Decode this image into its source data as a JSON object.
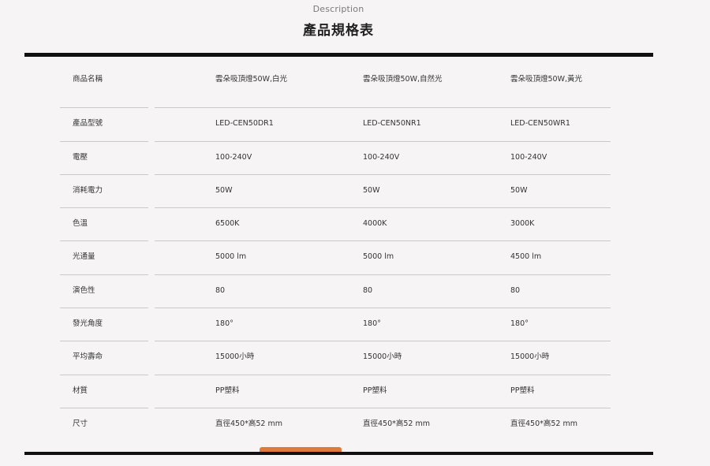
{
  "header": {
    "kicker": "Description",
    "title": "產品規格表"
  },
  "spec_table": {
    "rows": [
      {
        "label": "商品名稱",
        "values": [
          "雲朵吸頂燈50W,白光",
          "雲朵吸頂燈50W,自然光",
          "雲朵吸頂燈50W,黃光"
        ]
      },
      {
        "label": "產品型號",
        "values": [
          "LED-CEN50DR1",
          "LED-CEN50NR1",
          "LED-CEN50WR1"
        ]
      },
      {
        "label": "電壓",
        "values": [
          "100-240V",
          "100-240V",
          "100-240V"
        ]
      },
      {
        "label": "消耗電力",
        "values": [
          "50W",
          "50W",
          "50W"
        ]
      },
      {
        "label": "色溫",
        "values": [
          "6500K",
          "4000K",
          "3000K"
        ]
      },
      {
        "label": "光通量",
        "values": [
          "5000 lm",
          "5000 lm",
          "4500 lm"
        ]
      },
      {
        "label": "演色性",
        "values": [
          "80",
          "80",
          "80"
        ]
      },
      {
        "label": "發光角度",
        "values": [
          "180°",
          "180°",
          "180°"
        ]
      },
      {
        "label": "平均壽命",
        "values": [
          "15000小時",
          "15000小時",
          "15000小時"
        ]
      },
      {
        "label": "材質",
        "values": [
          "PP塑料",
          "PP塑料",
          "PP塑料"
        ]
      },
      {
        "label": "尺寸",
        "values": [
          "直徑450*高52 mm",
          "直徑450*高52 mm",
          "直徑450*高52 mm"
        ]
      }
    ]
  },
  "colors": {
    "background": "#f6f4f5",
    "rule": "#111111",
    "accent_tab": "#e07a3c",
    "divider": "#c9c9c9"
  }
}
